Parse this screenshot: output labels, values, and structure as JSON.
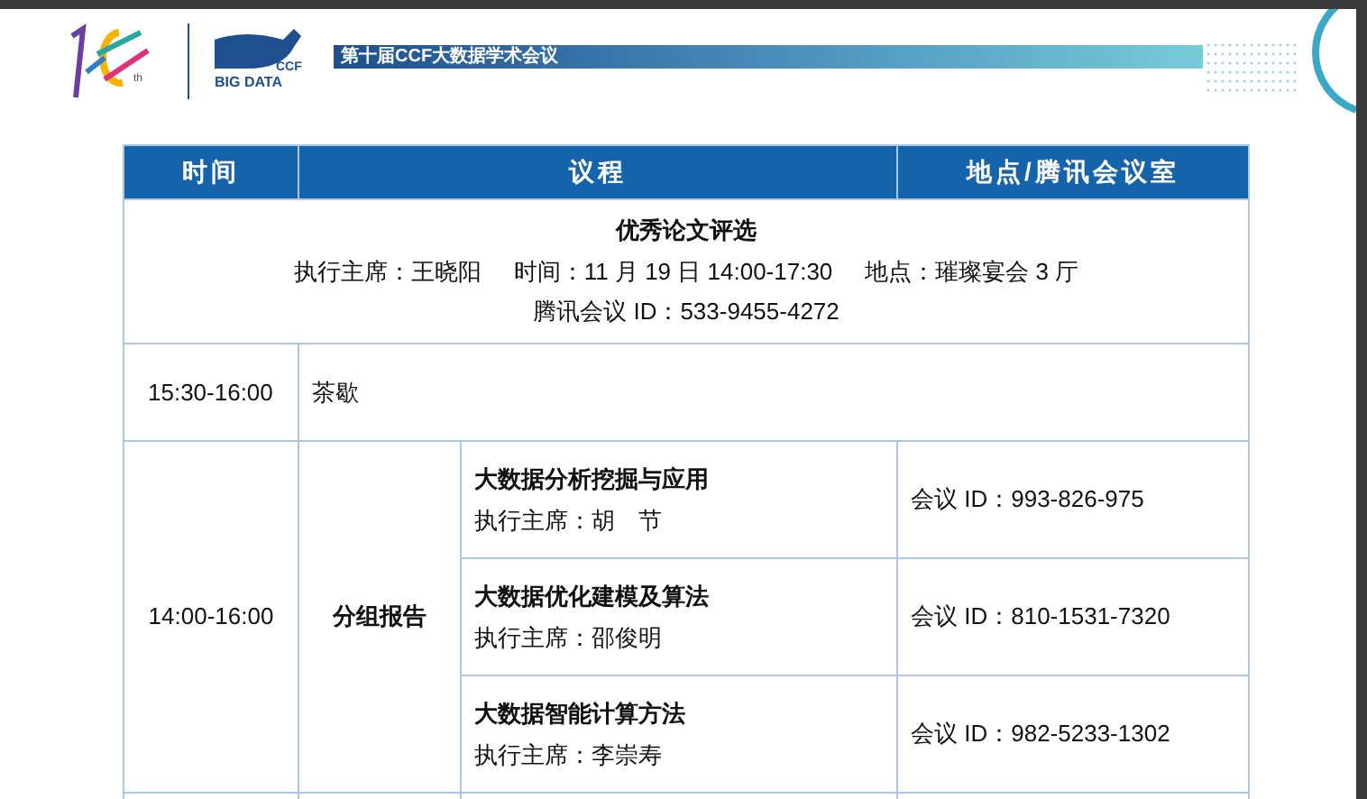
{
  "header": {
    "logo_mark": "th",
    "logo_brand": "CCF",
    "logo_name": "BIG DATA",
    "banner": "第十届CCF大数据学术会议"
  },
  "table": {
    "columns": [
      "时间",
      "议程",
      "地点/腾讯会议室"
    ],
    "plenary": {
      "title": "优秀论文评选",
      "details": [
        "执行主席：王晓阳",
        "时间：11 月 19 日 14:00-17:30",
        "地点：璀璨宴会 3 厅"
      ],
      "meeting": "腾讯会议 ID：533-9455-4272"
    },
    "break": {
      "time": "15:30-16:00",
      "label": "茶歇"
    },
    "sessions_block": {
      "time": "14:00-16:00",
      "label": "分组报告",
      "sessions": [
        {
          "title": "大数据分析挖掘与应用",
          "chair": "执行主席：胡　节",
          "room": "会议 ID：993-826-975"
        },
        {
          "title": "大数据优化建模及算法",
          "chair": "执行主席：邵俊明",
          "room": "会议 ID：810-1531-7320"
        },
        {
          "title": "大数据智能计算方法",
          "chair": "执行主席：李崇寿",
          "room": "会议 ID：982-5233-1302"
        }
      ]
    }
  }
}
